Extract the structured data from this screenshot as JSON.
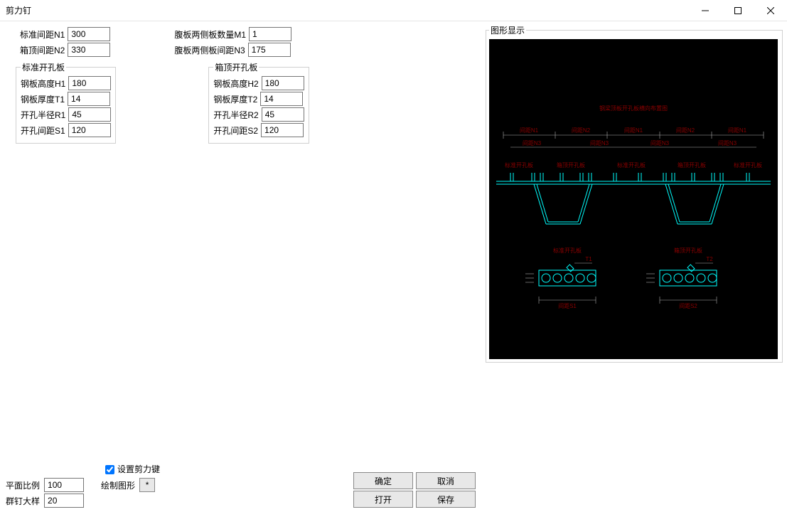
{
  "window": {
    "title": "剪力钉"
  },
  "top": {
    "n1_label": "标准间距N1",
    "n1_value": "300",
    "n2_label": "箱顶间距N2",
    "n2_value": "330",
    "m1_label": "腹板两侧板数量M1",
    "m1_value": "1",
    "n3_label": "腹板两侧板间距N3",
    "n3_value": "175"
  },
  "group1": {
    "legend": "标准开孔板",
    "h1_label": "钢板高度H1",
    "h1_value": "180",
    "t1_label": "钢板厚度T1",
    "t1_value": "14",
    "r1_label": "开孔半径R1",
    "r1_value": "45",
    "s1_label": "开孔间距S1",
    "s1_value": "120"
  },
  "group2": {
    "legend": "箱顶开孔板",
    "h2_label": "钢板高度H2",
    "h2_value": "180",
    "t2_label": "钢板厚度T2",
    "t2_value": "14",
    "r2_label": "开孔半径R2",
    "r2_value": "45",
    "s2_label": "开孔间距S2",
    "s2_value": "120"
  },
  "bottom": {
    "ck_label": "设置剪力键",
    "scale_label": "平面比例",
    "scale_value": "100",
    "draw_label": "绘制图形",
    "draw_btn": "*",
    "detail_label": "群钉大样",
    "detail_value": "20"
  },
  "buttons": {
    "ok": "确定",
    "cancel": "取消",
    "open": "打开",
    "save": "保存"
  },
  "graph": {
    "legend": "图形显示",
    "title": "钢梁顶板开孔板横向布置图",
    "dim_n1": "间距N1",
    "dim_n2": "间距N2",
    "dim_n3": "间距N3",
    "lbl_std": "标准开孔板",
    "lbl_top": "箱顶开孔板",
    "t1": "T1",
    "t2": "T2",
    "s1": "间距S1",
    "s2": "间距S2"
  }
}
